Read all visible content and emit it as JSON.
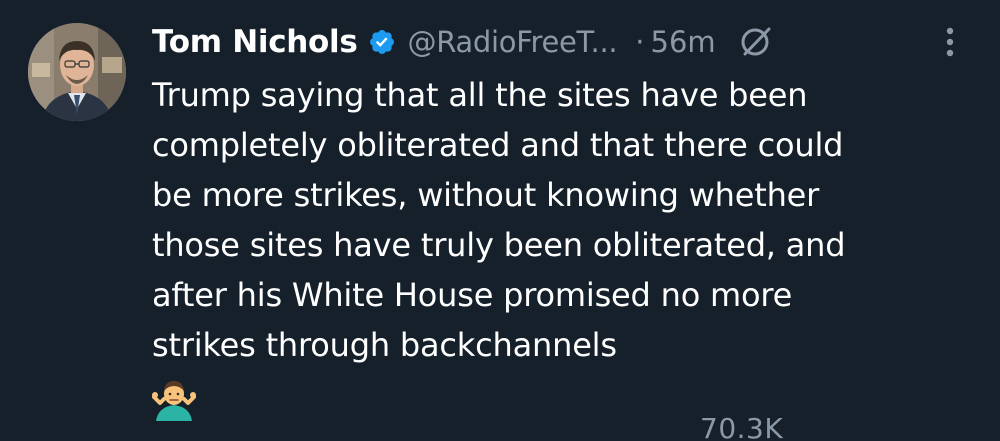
{
  "tweet": {
    "author_name": "Tom Nichols",
    "handle": "@RadioFreeT...",
    "separator": "·",
    "time": "56m",
    "text_lines": [
      "Trump saying that all the sites have been",
      "completely obliterated and that there could",
      "be more strikes, without knowing whether",
      "those sites have truly been obliterated, and",
      "after his White House promised no more",
      "strikes through backchannels"
    ],
    "emoji": "man-shrugging",
    "views": "70.3K"
  },
  "icons": {
    "avatar": "profile-photo",
    "verified": "verified-badge-icon",
    "grok": "grok-icon",
    "more": "more-options-icon"
  },
  "colors": {
    "background": "#15202b",
    "text": "#ffffff",
    "secondary_text": "#8b98a5",
    "verified_blue": "#1d9bf0"
  }
}
